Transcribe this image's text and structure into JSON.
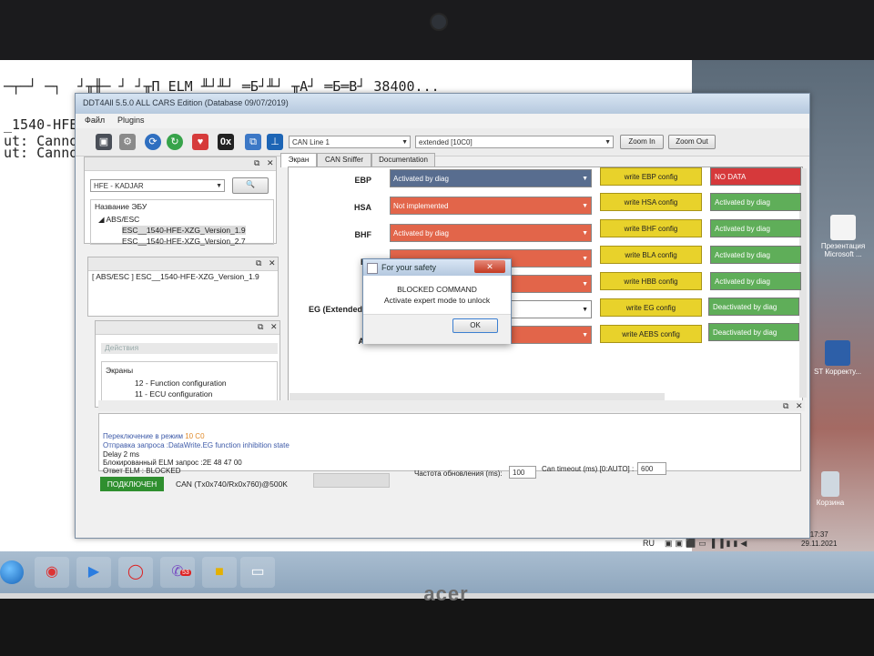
{
  "console": {
    "lines": [
      "─┬─┘ ─┐  ┘╥╫─ ┘ ┘╥П ELM ╨┘╨┘ ═Б┘╨┘ ╥А┘ ═Б═В┘ 38400...",
      "_1540-HFE",
      "ut: Canno",
      "ut: Canno"
    ]
  },
  "window": {
    "title": "DDT4All 5.5.0 ALL CARS Edition (Database 09/07/2019)",
    "menu": [
      "Файл",
      "Plugins"
    ],
    "toolbar": {
      "bus_combo": "CAN Line 1",
      "mode_combo": "extended [10C0]",
      "zoom_in": "Zoom In",
      "zoom_out": "Zoom Out",
      "icon_0x": "0x"
    }
  },
  "left": {
    "vehicle_combo": "HFE - KADJAR",
    "tree_header": "Название ЭБУ",
    "tree_group": "ABS/ESC",
    "tree_items": [
      "ESC__1540-HFE-XZG_Version_1.9",
      "ESC__1540-HFE-XZG_Version_2.7"
    ],
    "selected_ecu": "[ ABS/ESC ] ESC__1540-HFE-XZG_Version_1.9",
    "actions_label": "Действия",
    "screens_label": "Экраны",
    "screens": [
      "12 - Function configuration",
      "11 - ECU configuration"
    ]
  },
  "tabs": [
    "Экран",
    "CAN Sniffer",
    "Documentation"
  ],
  "rows": [
    {
      "label": "EBP",
      "state": "Activated by diag",
      "state_color": "#586d8f",
      "write": "write EBP config",
      "status": "NO DATA",
      "status_color": "#d6393b"
    },
    {
      "label": "HSA",
      "state": "Not implemented",
      "state_color": "#e2654a",
      "write": "write HSA config",
      "status": "Activated by diag",
      "status_color": "#5fae59"
    },
    {
      "label": "BHF",
      "state": "Activated by diag",
      "state_color": "#e2654a",
      "write": "write BHF config",
      "status": "Activated by diag",
      "status_color": "#5fae59"
    },
    {
      "label": "BL",
      "state": "",
      "state_color": "#e2654a",
      "write": "write BLA config",
      "status": "Activated by diag",
      "status_color": "#5fae59"
    },
    {
      "label": "HI",
      "state": "",
      "state_color": "#e2654a",
      "write": "write HBB config",
      "status": "Activated by diag",
      "status_color": "#5fae59"
    },
    {
      "label": "EG (Extended",
      "state": "",
      "state_color": "#ffffff",
      "write": "write EG config",
      "status": "Deactivated by diag",
      "status_color": "#5fae59"
    },
    {
      "label": "A",
      "state": "",
      "state_color": "#e2654a",
      "write": "write AEBS config",
      "status": "Deactivated by diag",
      "status_color": "#5fae59"
    }
  ],
  "dialog": {
    "title": "For your safety",
    "heading": "BLOCKED COMMAND",
    "message": "Activate expert mode to unlock",
    "ok": "OK",
    "close": "✕"
  },
  "log": {
    "lines": [
      {
        "a": "Переключение в режим ",
        "b": "10 C0"
      },
      {
        "a": "Отправка запроса :DataWrite.EG function inhibition state",
        "b": ""
      },
      {
        "a": "Delay 2 ms",
        "b": ""
      },
      {
        "a": "Блокированный ELM запрос :2E 48 47 00",
        "b": ""
      },
      {
        "a": "Ответ ELM : BLOCKED",
        "b": ""
      }
    ]
  },
  "status": {
    "connected": "ПОДКЛЮЧЕН",
    "can_info": "CAN (Tx0x740/Rx0x760)@500K",
    "refresh_label": "Частота обновления (ms):",
    "refresh_value": "100",
    "timeout_label": "Can timeout (ms) [0:AUTO] :",
    "timeout_value": "600"
  },
  "desktop": {
    "icons": [
      "Презентация Microsoft ...",
      "ST Корректу...",
      "Корзина"
    ]
  },
  "taskbar": {
    "lang": "RU",
    "clock_time": "17:37",
    "clock_date": "29.11.2021",
    "badge": "53"
  },
  "brand": "acer"
}
